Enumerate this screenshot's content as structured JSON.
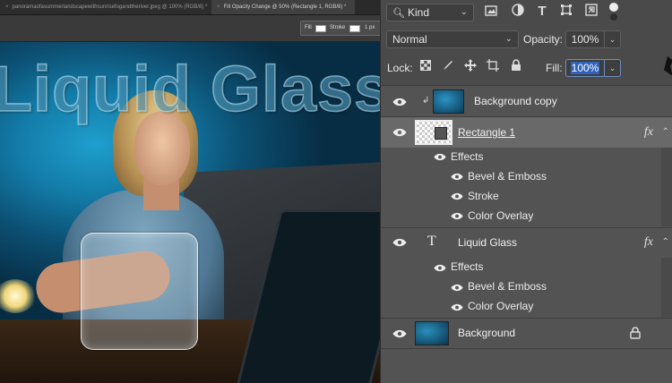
{
  "document": {
    "tab1_label": "panoramaofasummerlandscapewithsunrisefogandtheriver.jpeg @ 100% (RGB/8) *",
    "tab2_label": "Fill Opacity Change @ 50% (Rectangle 1, RGB/8) *",
    "tab_close": "×",
    "options": {
      "fill_label": "Fill",
      "stroke_label": "Stroke",
      "stroke_size": "1 px"
    },
    "canvas_text": "Liquid Glass"
  },
  "layers_panel": {
    "filter_kind": "Kind",
    "filter_icons": [
      "image-filter-icon",
      "adjustment-filter-icon",
      "type-filter-icon",
      "shape-filter-icon",
      "smart-object-filter-icon"
    ],
    "blend_mode": "Normal",
    "opacity_label": "Opacity:",
    "opacity_value": "100%",
    "lock_label": "Lock:",
    "fill_label": "Fill:",
    "fill_value": "100%",
    "layers": [
      {
        "name": "Background copy"
      },
      {
        "name": "Rectangle 1",
        "fx": "fx",
        "effects_label": "Effects",
        "effects": [
          "Bevel & Emboss",
          "Stroke",
          "Color Overlay"
        ]
      },
      {
        "name": "Liquid Glass",
        "type_glyph": "T",
        "fx": "fx",
        "effects_label": "Effects",
        "effects": [
          "Bevel & Emboss",
          "Color Overlay"
        ]
      },
      {
        "name": "Background"
      }
    ]
  },
  "colors": {
    "panel_bg": "#535353",
    "selected_row": "#696969",
    "fill_highlight": "#2f62b8"
  }
}
